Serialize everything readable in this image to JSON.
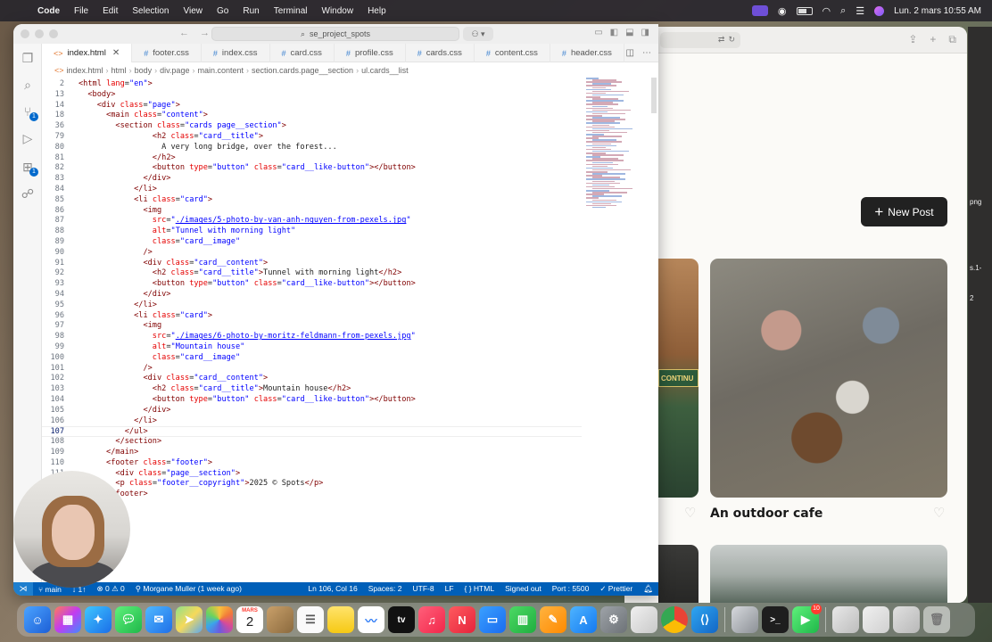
{
  "menubar": {
    "app": "Code",
    "items": [
      "File",
      "Edit",
      "Selection",
      "View",
      "Go",
      "Run",
      "Terminal",
      "Window",
      "Help"
    ],
    "clock": "Lun. 2 mars  10:55 AM"
  },
  "browser": {
    "new_post_label": "New Post",
    "card_title": "An outdoor cafe",
    "sign_text": "CONTINU",
    "side_frags": [
      "png",
      "s.1-",
      "2"
    ]
  },
  "vscode": {
    "search": "se_project_spots",
    "tabs": [
      {
        "label": "index.html",
        "kind": "html",
        "active": true
      },
      {
        "label": "footer.css",
        "kind": "css"
      },
      {
        "label": "index.css",
        "kind": "css"
      },
      {
        "label": "card.css",
        "kind": "css"
      },
      {
        "label": "profile.css",
        "kind": "css"
      },
      {
        "label": "cards.css",
        "kind": "css"
      },
      {
        "label": "content.css",
        "kind": "css"
      },
      {
        "label": "header.css",
        "kind": "css"
      }
    ],
    "breadcrumb": [
      "index.html",
      "html",
      "body",
      "div.page",
      "main.content",
      "section.cards.page__section",
      "ul.cards__list"
    ],
    "code_lines": [
      {
        "n": "2",
        "ind": 0,
        "s": true
      },
      {
        "n": "13",
        "ind": 1,
        "s": true
      },
      {
        "n": "14",
        "ind": 2,
        "s": true
      },
      {
        "n": "18",
        "ind": 3,
        "s": true
      },
      {
        "n": "36",
        "ind": 4,
        "s": true
      },
      {
        "n": "79",
        "ind": 8
      },
      {
        "n": "80",
        "ind": 9
      },
      {
        "n": "81",
        "ind": 8
      },
      {
        "n": "82",
        "ind": 8
      },
      {
        "n": "83",
        "ind": 7
      },
      {
        "n": "84",
        "ind": 6
      },
      {
        "n": "85",
        "ind": 7
      },
      {
        "n": "86",
        "ind": 8
      },
      {
        "n": "87",
        "ind": 8
      },
      {
        "n": "88",
        "ind": 8
      },
      {
        "n": "89",
        "ind": 7
      },
      {
        "n": "90",
        "ind": 7
      },
      {
        "n": "91",
        "ind": 8
      },
      {
        "n": "92",
        "ind": 8
      },
      {
        "n": "93",
        "ind": 7
      },
      {
        "n": "94",
        "ind": 6
      },
      {
        "n": "95",
        "ind": 6
      },
      {
        "n": "96",
        "ind": 7
      },
      {
        "n": "97",
        "ind": 8
      },
      {
        "n": "98",
        "ind": 8
      },
      {
        "n": "99",
        "ind": 8
      },
      {
        "n": "100",
        "ind": 7
      },
      {
        "n": "101",
        "ind": 7
      },
      {
        "n": "102",
        "ind": 8
      },
      {
        "n": "103",
        "ind": 8
      },
      {
        "n": "104",
        "ind": 7
      },
      {
        "n": "105",
        "ind": 6
      },
      {
        "n": "106",
        "ind": 5,
        "cur": true
      },
      {
        "n": "107",
        "ind": 4
      },
      {
        "n": "108",
        "ind": 3
      },
      {
        "n": "109",
        "ind": 3
      },
      {
        "n": "110",
        "ind": 4
      },
      {
        "n": "111",
        "ind": 4
      },
      {
        "n": "112",
        "ind": 3
      }
    ],
    "status": {
      "branch": "main",
      "sync": "↓ 1↑",
      "problems": "⊗ 0 ⚠ 0",
      "author": "Morgane Muller (1 week ago)",
      "position": "Ln 106, Col 16",
      "spaces": "Spaces: 2",
      "encoding": "UTF-8",
      "eol": "LF",
      "language": "{ } HTML",
      "account": "Signed out",
      "port": "Port : 5500",
      "formatter": "✓ Prettier"
    }
  },
  "dock": {
    "calendar_month": "MARS",
    "calendar_day": "2",
    "messages_badge": "",
    "facetime_badge": "10"
  },
  "colors": {
    "accent": "#005fb8",
    "tag": "#800000",
    "attr": "#e50000",
    "value": "#0000ff"
  }
}
